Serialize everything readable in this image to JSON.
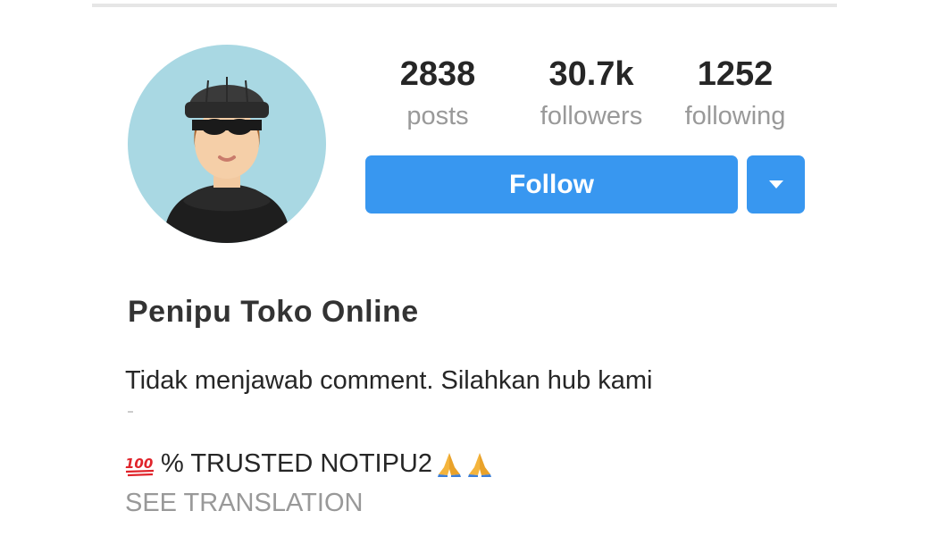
{
  "profile": {
    "name": "Penipu Toko Online",
    "bio_line_1": "Tidak menjawab comment. Silahkan hub kami",
    "bio_line_2_text": "% TRUSTED NOTIPU2",
    "bio_line_2_emojis": [
      "hundred-points-icon",
      "folded-hands-icon",
      "folded-hands-icon"
    ],
    "see_translation": "SEE TRANSLATION",
    "avatar_icon": "masked-thief-avatar"
  },
  "stats": {
    "posts": {
      "value": "2838",
      "label": "posts"
    },
    "followers": {
      "value": "30.7k",
      "label": "followers"
    },
    "following": {
      "value": "1252",
      "label": "following"
    }
  },
  "actions": {
    "follow_label": "Follow",
    "dropdown_icon": "caret-down-icon"
  },
  "colors": {
    "button_blue": "#3897f0",
    "avatar_bg": "#a9d8e3",
    "muted_text": "#999999",
    "primary_text": "#262626"
  }
}
